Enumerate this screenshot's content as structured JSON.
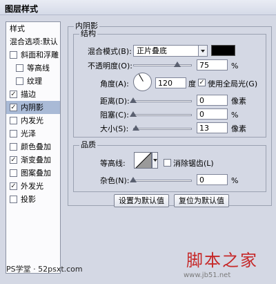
{
  "window": {
    "title": "图层样式"
  },
  "sidebar": {
    "items": [
      {
        "label": "样式",
        "checkbox": false,
        "checked": false,
        "selected": false
      },
      {
        "label": "混合选项:默认",
        "checkbox": false,
        "checked": false,
        "selected": false
      },
      {
        "label": "斜面和浮雕",
        "checkbox": true,
        "checked": false,
        "selected": false
      },
      {
        "label": "等高线",
        "checkbox": true,
        "checked": false,
        "selected": false
      },
      {
        "label": "纹理",
        "checkbox": true,
        "checked": false,
        "selected": false
      },
      {
        "label": "描边",
        "checkbox": true,
        "checked": true,
        "selected": false
      },
      {
        "label": "内阴影",
        "checkbox": true,
        "checked": true,
        "selected": true
      },
      {
        "label": "内发光",
        "checkbox": true,
        "checked": false,
        "selected": false
      },
      {
        "label": "光泽",
        "checkbox": true,
        "checked": false,
        "selected": false
      },
      {
        "label": "颜色叠加",
        "checkbox": true,
        "checked": false,
        "selected": false
      },
      {
        "label": "渐变叠加",
        "checkbox": true,
        "checked": true,
        "selected": false
      },
      {
        "label": "图案叠加",
        "checkbox": true,
        "checked": false,
        "selected": false
      },
      {
        "label": "外发光",
        "checkbox": true,
        "checked": true,
        "selected": false
      },
      {
        "label": "投影",
        "checkbox": true,
        "checked": false,
        "selected": false
      }
    ]
  },
  "panel": {
    "title": "内阴影",
    "structure": {
      "title": "结构",
      "blend_mode_label": "混合模式(B):",
      "blend_mode_value": "正片叠底",
      "color": "#000000",
      "opacity_label": "不透明度(O):",
      "opacity_value": "75",
      "opacity_unit": "%",
      "opacity_fraction": 0.75,
      "angle_label": "角度(A):",
      "angle_value": "120",
      "angle_unit": "度",
      "global_light_label": "使用全局光(G)",
      "global_light_checked": true,
      "distance_label": "距离(D):",
      "distance_value": "0",
      "distance_unit": "像素",
      "choke_label": "阻塞(C):",
      "choke_value": "0",
      "choke_unit": "%",
      "size_label": "大小(S):",
      "size_value": "13",
      "size_unit": "像素",
      "size_fraction": 0.052
    },
    "quality": {
      "title": "品质",
      "contour_label": "等高线:",
      "antialias_label": "消除锯齿(L)",
      "antialias_checked": false,
      "noise_label": "杂色(N):",
      "noise_value": "0",
      "noise_unit": "%"
    },
    "buttons": {
      "set_default": "设置为默认值",
      "reset_default": "复位为默认值"
    }
  },
  "watermark": {
    "ps": "PS学堂 · 52psxt.com",
    "jb_logo": "脚本之家",
    "jb_url": "www.jb51.net"
  },
  "check_glyph": "✓"
}
